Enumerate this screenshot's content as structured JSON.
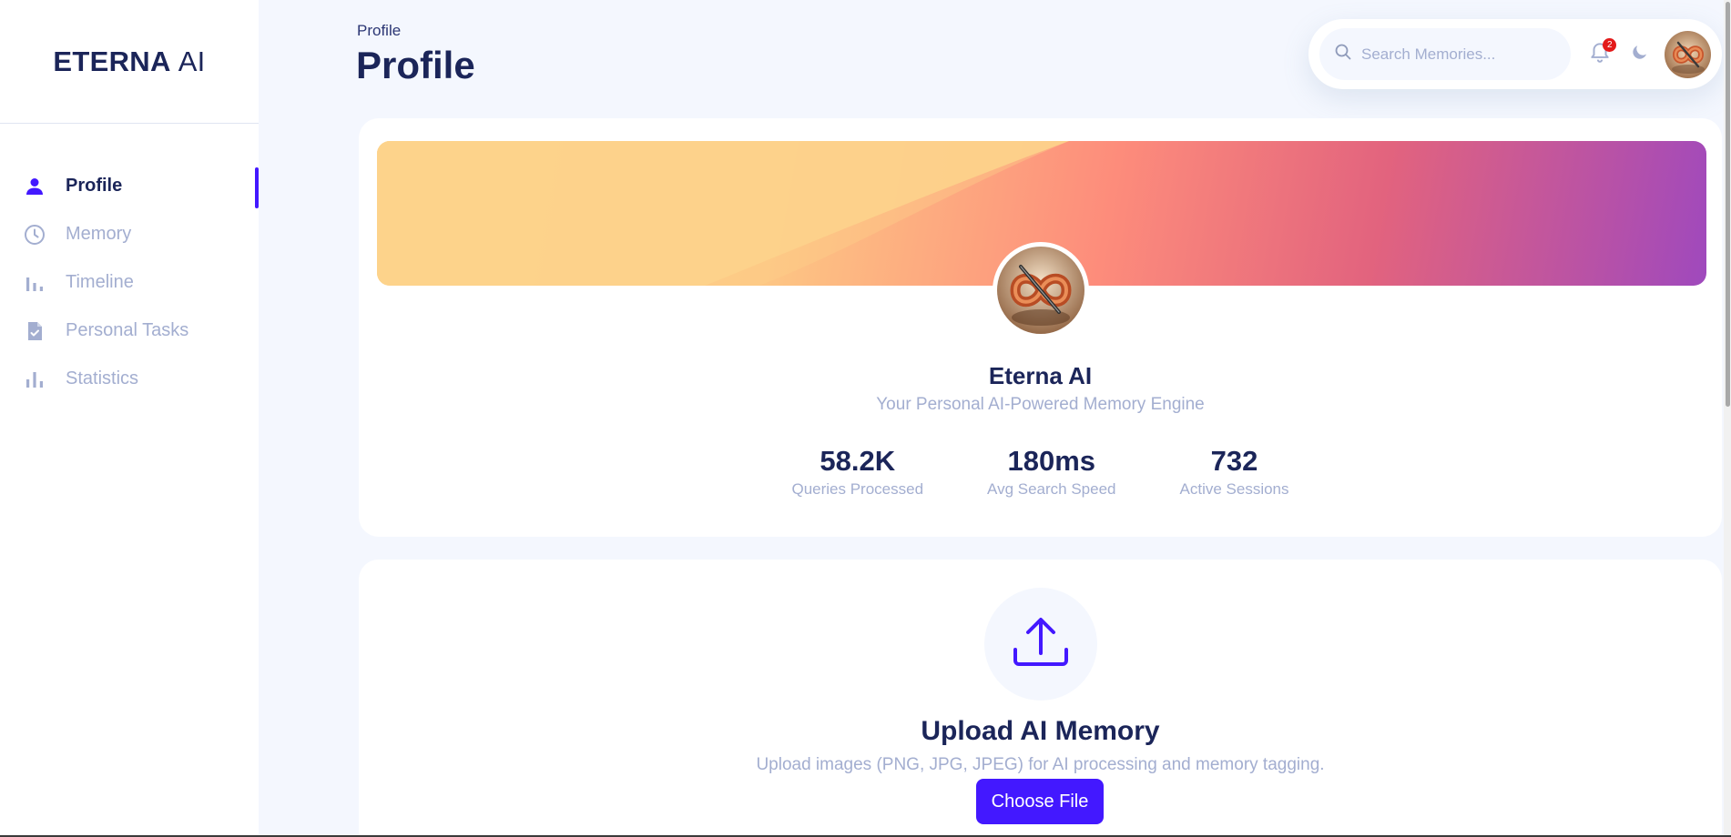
{
  "brand": {
    "bold": "ETERNA",
    "light": "AI"
  },
  "sidebar": {
    "items": [
      {
        "label": "Profile",
        "icon": "person-icon",
        "active": true
      },
      {
        "label": "Memory",
        "icon": "clock-icon",
        "active": false
      },
      {
        "label": "Timeline",
        "icon": "bar-chart-icon",
        "active": false
      },
      {
        "label": "Personal Tasks",
        "icon": "task-document-icon",
        "active": false
      },
      {
        "label": "Statistics",
        "icon": "statistics-icon",
        "active": false
      }
    ]
  },
  "header": {
    "breadcrumb": "Profile",
    "title": "Profile",
    "search_placeholder": "Search Memories...",
    "notification_count": "2"
  },
  "profile": {
    "name": "Eterna AI",
    "tagline": "Your Personal AI-Powered Memory Engine",
    "stats": [
      {
        "value": "58.2K",
        "label": "Queries Processed"
      },
      {
        "value": "180ms",
        "label": "Avg Search Speed"
      },
      {
        "value": "732",
        "label": "Active Sessions"
      }
    ]
  },
  "upload": {
    "title": "Upload AI Memory",
    "description": "Upload images (PNG, JPG, JPEG) for AI processing and memory tagging.",
    "button_label": "Choose File"
  },
  "colors": {
    "accent": "#4318ff",
    "text_primary": "#1b2559",
    "text_muted": "#a3aed0",
    "background": "#f4f7fe",
    "badge": "#e31a1a"
  }
}
